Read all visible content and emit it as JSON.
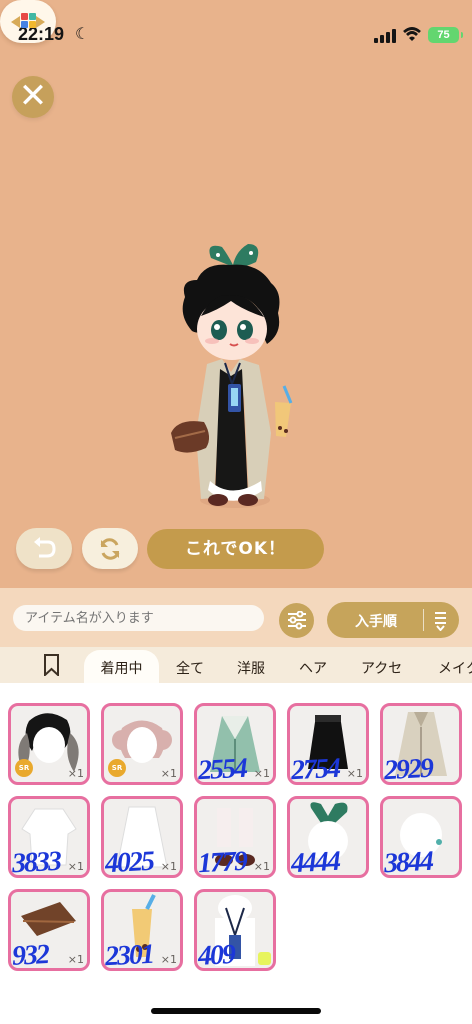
{
  "status_bar": {
    "time": "22:19",
    "battery": "75"
  },
  "header": {
    "close_label": "✕"
  },
  "actions": {
    "ok_label": "これでOK！"
  },
  "search": {
    "placeholder": "アイテム名が入ります",
    "sort_label": "入手順"
  },
  "tabs": [
    {
      "label": "着用中"
    },
    {
      "label": "全て"
    },
    {
      "label": "洋服"
    },
    {
      "label": "ヘア"
    },
    {
      "label": "アクセ"
    },
    {
      "label": "メイク"
    }
  ],
  "items": [
    {
      "qty": "×1",
      "badge": "SR",
      "handwritten": ""
    },
    {
      "qty": "×1",
      "badge": "SR",
      "handwritten": ""
    },
    {
      "qty": "×1",
      "badge": "",
      "handwritten": "2554"
    },
    {
      "qty": "×1",
      "badge": "",
      "handwritten": "2754"
    },
    {
      "qty": "",
      "badge": "",
      "handwritten": "2929"
    },
    {
      "qty": "×1",
      "badge": "",
      "handwritten": "3833"
    },
    {
      "qty": "×1",
      "badge": "",
      "handwritten": "4025"
    },
    {
      "qty": "×1",
      "badge": "",
      "handwritten": "1779"
    },
    {
      "qty": "",
      "badge": "",
      "handwritten": "4444"
    },
    {
      "qty": "",
      "badge": "",
      "handwritten": "3844"
    },
    {
      "qty": "×1",
      "badge": "",
      "handwritten": "932"
    },
    {
      "qty": "×1",
      "badge": "",
      "handwritten": "2301"
    },
    {
      "qty": "",
      "badge": "",
      "handwritten": "409"
    }
  ],
  "colors": {
    "background": "#e8b38c",
    "gold": "#c6a45b",
    "item_border": "#e76fa0",
    "handwriting": "#1c37d8"
  }
}
